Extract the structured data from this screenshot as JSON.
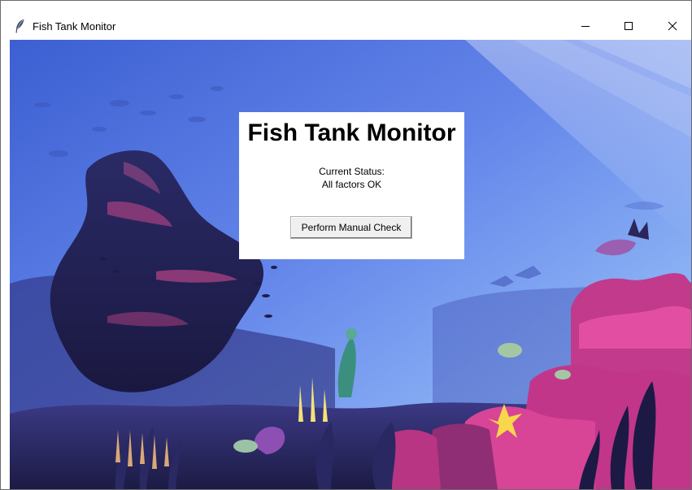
{
  "window": {
    "title": "Fish Tank Monitor",
    "icon": "feather-icon",
    "controls": [
      "minimize-icon",
      "maximize-icon",
      "close-icon"
    ]
  },
  "panel": {
    "heading": "Fish Tank Monitor",
    "status_label": "Current Status:",
    "status_value": "All factors OK",
    "check_button_label": "Perform Manual Check"
  },
  "background": {
    "description_icon": "underwater-scene"
  }
}
